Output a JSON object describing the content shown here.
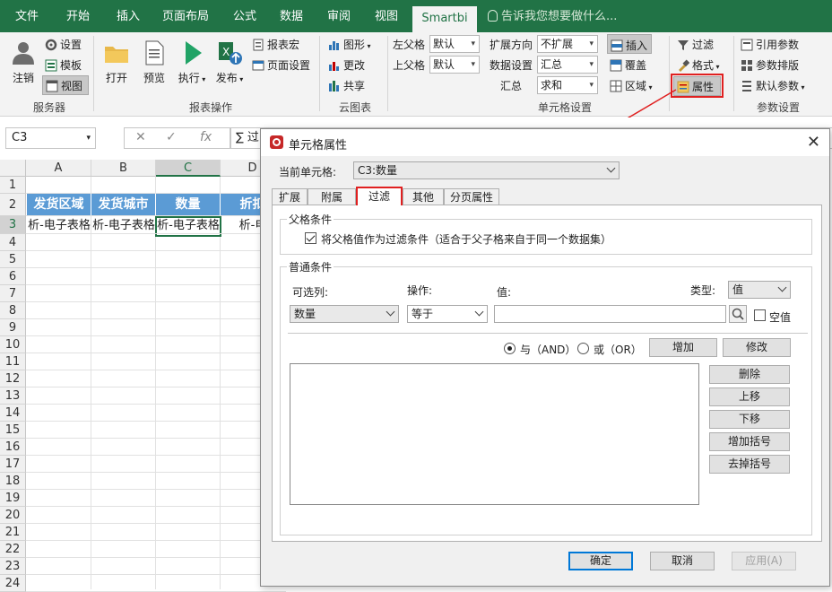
{
  "ribbon_tabs": [
    "文件",
    "开始",
    "插入",
    "页面布局",
    "公式",
    "数据",
    "审阅",
    "视图",
    "Smartbi"
  ],
  "active_tab": "Smartbi",
  "tell_me": "告诉我您想要做什么...",
  "ribbon": {
    "server": {
      "logout": "注销",
      "settings": "设置",
      "template": "模板",
      "view": "视图",
      "group": "服务器"
    },
    "report": {
      "open": "打开",
      "preview": "预览",
      "execute": "执行",
      "publish": "发布",
      "macro": "报表宏",
      "page_setup": "页面设置",
      "group": "报表操作"
    },
    "cloud": {
      "graphic": "图形",
      "change": "更改",
      "share": "共享",
      "group": "云图表"
    },
    "cell": {
      "left_parent": "左父格",
      "left_parent_val": "默认",
      "top_parent": "上父格",
      "top_parent_val": "默认",
      "expand_dir": "扩展方向",
      "expand_dir_val": "不扩展",
      "data_setting": "数据设置",
      "data_setting_val": "汇总",
      "summary": "汇总",
      "summary_val": "求和",
      "insert": "插入",
      "cover": "覆盖",
      "area": "区域",
      "group": "单元格设置"
    },
    "filter": {
      "filter": "过滤",
      "format": "格式",
      "property": "属性"
    },
    "param": {
      "ref_param": "引用参数",
      "param_layout": "参数排版",
      "default_param": "默认参数",
      "group": "参数设置"
    }
  },
  "formula_bar": {
    "name_box": "C3",
    "formula": "∑ 过"
  },
  "sheet": {
    "columns": [
      "A",
      "B",
      "C",
      "D"
    ],
    "rows": [
      "1",
      "2",
      "3",
      "4",
      "5",
      "6",
      "7",
      "8",
      "9",
      "10",
      "11",
      "12",
      "13",
      "14",
      "15",
      "16",
      "17",
      "18",
      "19",
      "20",
      "21",
      "22",
      "23",
      "24"
    ],
    "headers": [
      "发货区域",
      "发货城市",
      "数量",
      "折扣"
    ],
    "data_row": [
      "析-电子表格",
      "析-电子表格",
      "析-电子表格",
      "析-电"
    ]
  },
  "dialog": {
    "title": "单元格属性",
    "current_cell_label": "当前单元格:",
    "current_cell_value": "C3:数量",
    "tabs": [
      "扩展",
      "附属",
      "过滤",
      "其他",
      "分页属性"
    ],
    "active_tab": "过滤",
    "parent_section": "父格条件",
    "parent_checkbox": "将父格值作为过滤条件（适合于父子格来自于同一个数据集）",
    "common_section": "普通条件",
    "col_label": "可选列:",
    "op_label": "操作:",
    "value_label": "值:",
    "type_label": "类型:",
    "col_value": "数量",
    "op_value": "等于",
    "type_value": "值",
    "value_input": "",
    "null_label": "空值",
    "and_label": "与（AND）",
    "or_label": "或（OR）",
    "add": "增加",
    "modify": "修改",
    "delete": "删除",
    "move_up": "上移",
    "move_down": "下移",
    "add_bracket": "增加括号",
    "remove_bracket": "去掉括号",
    "ok": "确定",
    "cancel": "取消",
    "apply": "应用(A)"
  },
  "colors": {
    "excel_green": "#217346",
    "header_blue": "#5b9bd5",
    "highlight_red": "#e02020"
  }
}
